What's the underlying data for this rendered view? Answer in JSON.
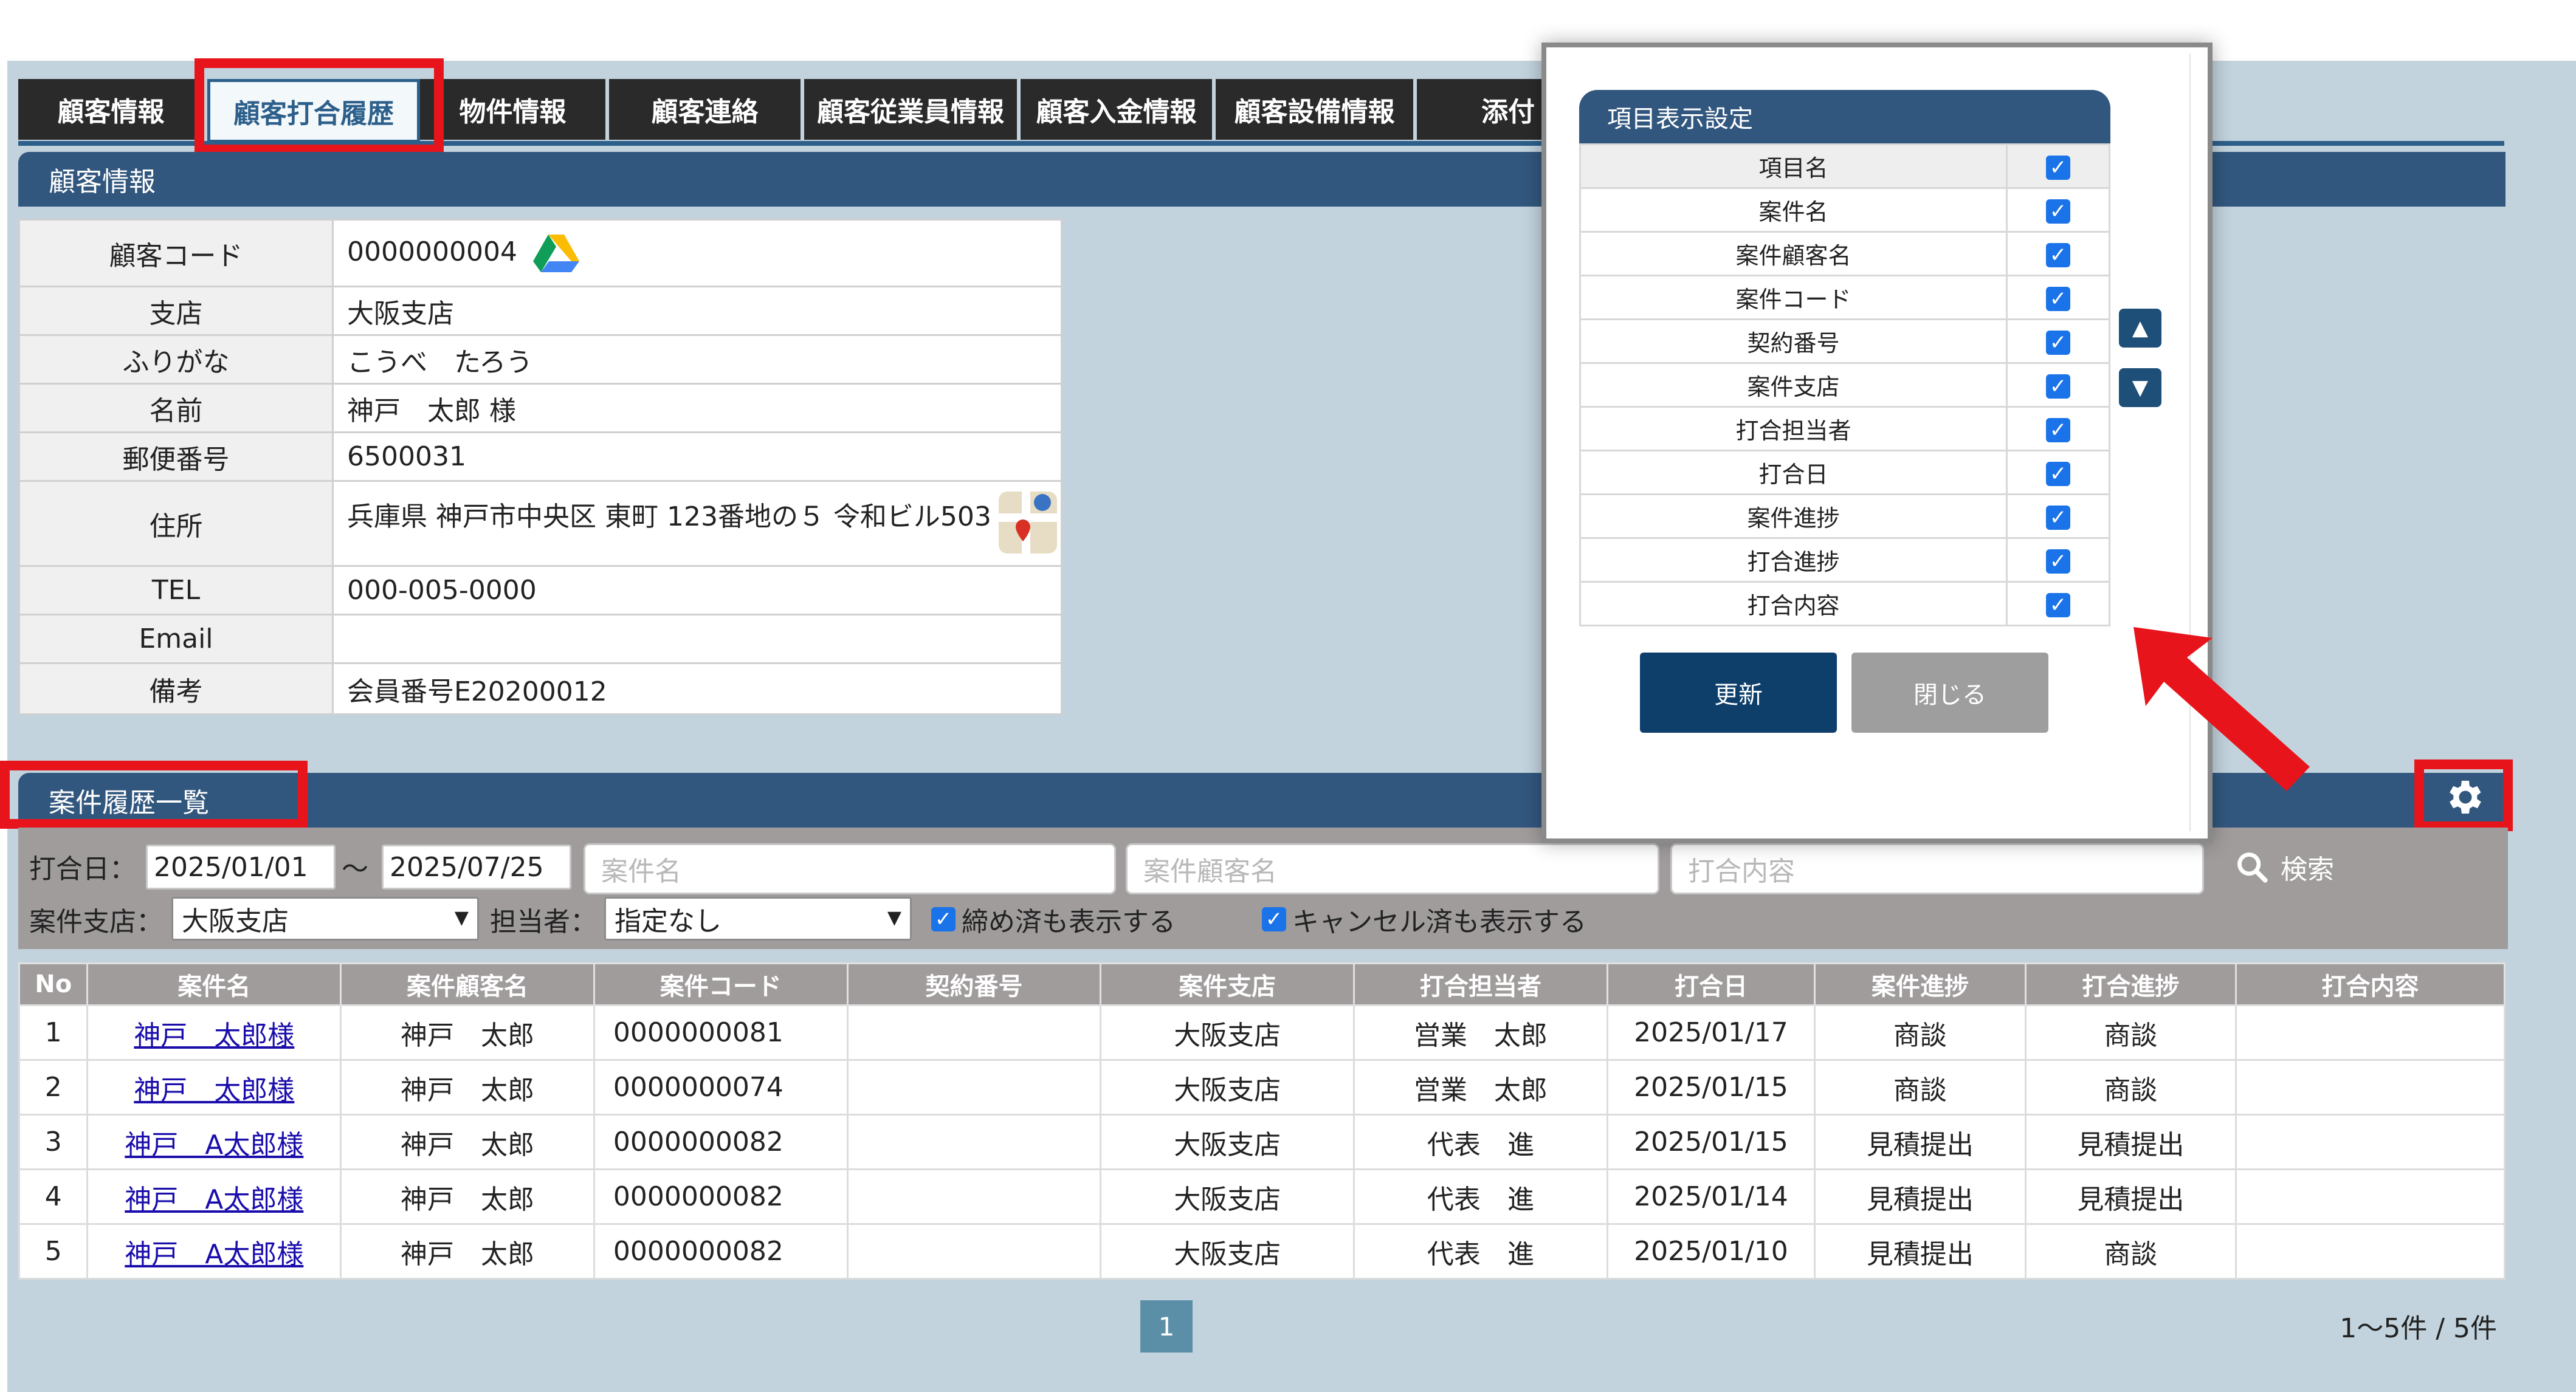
{
  "tabs": [
    "顧客情報",
    "顧客打合履歴",
    "物件情報",
    "顧客連絡",
    "顧客従業員情報",
    "顧客入金情報",
    "顧客設備情報",
    "添付"
  ],
  "active_tab": "顧客打合履歴",
  "customer_section": {
    "title": "顧客情報",
    "rows": [
      {
        "label": "顧客コード",
        "value": "0000000004"
      },
      {
        "label": "支店",
        "value": "大阪支店"
      },
      {
        "label": "ふりがな",
        "value": "こうべ　たろう"
      },
      {
        "label": "名前",
        "value": "神戸　太郎 様"
      },
      {
        "label": "郵便番号",
        "value": "6500031"
      },
      {
        "label": "住所",
        "value": "兵庫県 神戸市中央区 東町 123番地の５ 令和ビル503"
      },
      {
        "label": "TEL",
        "value": "000-005-0000"
      },
      {
        "label": "Email",
        "value": ""
      },
      {
        "label": "備考",
        "value": "会員番号E20200012"
      }
    ]
  },
  "history_section": {
    "title": "案件履歴一覧"
  },
  "filter": {
    "date_label": "打合日：",
    "date_from": "2025/01/01",
    "tilde": "～",
    "date_to": "2025/07/25",
    "case_name_placeholder": "案件名",
    "case_customer_placeholder": "案件顧客名",
    "content_placeholder": "打合内容",
    "search_label": "検索",
    "branch_label": "案件支店：",
    "branch_value": "大阪支店",
    "staff_label": "担当者：",
    "staff_value": "指定なし",
    "show_closed_label": "締め済も表示する",
    "show_cancelled_label": "キャンセル済も表示する"
  },
  "table": {
    "headers": [
      "No",
      "案件名",
      "案件顧客名",
      "案件コード",
      "契約番号",
      "案件支店",
      "打合担当者",
      "打合日",
      "案件進捗",
      "打合進捗",
      "打合内容"
    ],
    "rows": [
      [
        "1",
        "神戸　太郎様",
        "神戸　太郎",
        "0000000081",
        "",
        "大阪支店",
        "営業　太郎",
        "2025/01/17",
        "商談",
        "商談",
        ""
      ],
      [
        "2",
        "神戸　太郎様",
        "神戸　太郎",
        "0000000074",
        "",
        "大阪支店",
        "営業　太郎",
        "2025/01/15",
        "商談",
        "商談",
        ""
      ],
      [
        "3",
        "神戸　A太郎様",
        "神戸　太郎",
        "0000000082",
        "",
        "大阪支店",
        "代表　進",
        "2025/01/15",
        "見積提出",
        "見積提出",
        ""
      ],
      [
        "4",
        "神戸　A太郎様",
        "神戸　太郎",
        "0000000082",
        "",
        "大阪支店",
        "代表　進",
        "2025/01/14",
        "見積提出",
        "見積提出",
        ""
      ],
      [
        "5",
        "神戸　A太郎様",
        "神戸　太郎",
        "0000000082",
        "",
        "大阪支店",
        "代表　進",
        "2025/01/10",
        "見積提出",
        "商談",
        ""
      ]
    ]
  },
  "pagination": {
    "current_page": "1",
    "summary": "1～5件 / 5件"
  },
  "popup": {
    "title": "項目表示設定",
    "items": [
      "項目名",
      "案件名",
      "案件顧客名",
      "案件コード",
      "契約番号",
      "案件支店",
      "打合担当者",
      "打合日",
      "案件進捗",
      "打合進捗",
      "打合内容"
    ],
    "update_label": "更新",
    "close_label": "閉じる"
  },
  "colors": {
    "accent": "#32577e",
    "highlight": "#e8141b",
    "checkbox": "#1a73e8"
  }
}
